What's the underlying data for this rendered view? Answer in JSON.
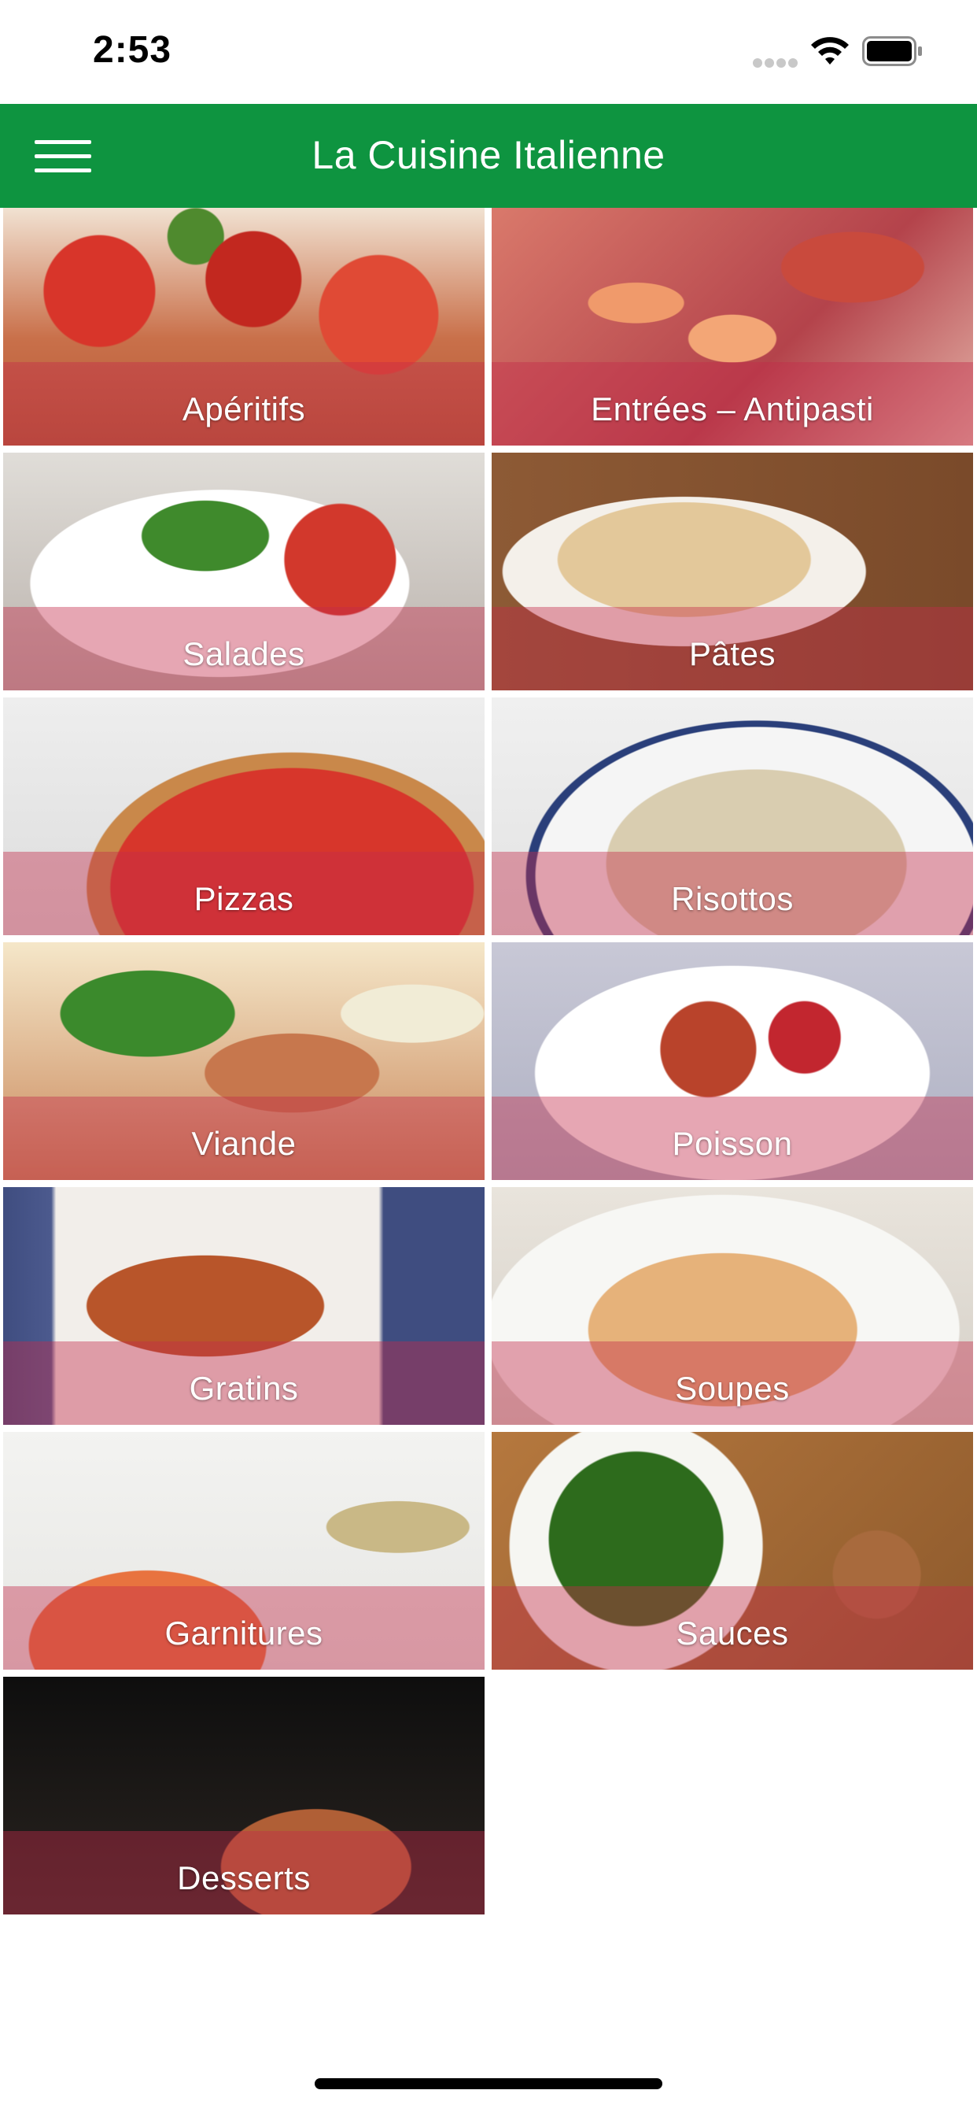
{
  "status_bar": {
    "time": "2:53",
    "icons": [
      "cellular-signal-icon",
      "wifi-icon",
      "battery-icon"
    ]
  },
  "nav": {
    "title": "La Cuisine Italienne",
    "menu_icon": "hamburger-menu-icon",
    "background_color": "#0e9440"
  },
  "categories": [
    {
      "label": "Apéritifs"
    },
    {
      "label": "Entrées – Antipasti"
    },
    {
      "label": "Salades"
    },
    {
      "label": "Pâtes"
    },
    {
      "label": "Pizzas"
    },
    {
      "label": "Risottos"
    },
    {
      "label": "Viande"
    },
    {
      "label": "Poisson"
    },
    {
      "label": "Gratins"
    },
    {
      "label": "Soupes"
    },
    {
      "label": "Garnitures"
    },
    {
      "label": "Sauces"
    },
    {
      "label": "Desserts"
    }
  ],
  "colors": {
    "label_band": "#c42c4a",
    "label_text": "#ffffff"
  }
}
